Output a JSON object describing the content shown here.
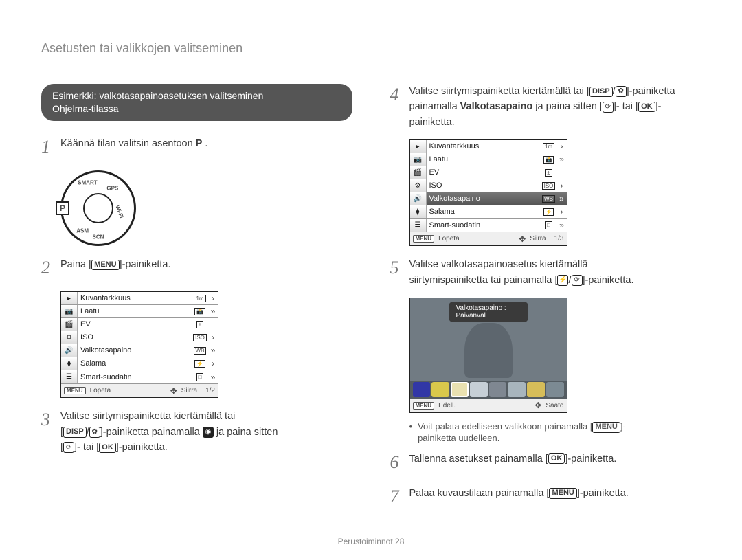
{
  "page_title": "Asetusten tai valikkojen valitseminen",
  "pill": {
    "line1": "Esimerkki: valkotasapainoasetuksen valitseminen",
    "line2": "Ohjelma-tilassa"
  },
  "dial": {
    "P": "P",
    "top": "SMART",
    "right_top": "GPS",
    "right_bottom": "Wi-Fi",
    "left_bottom": "ASM",
    "bottom": "SCN"
  },
  "buttons": {
    "menu": "MENU",
    "disp": "DISP",
    "ok": "OK"
  },
  "steps_left": {
    "1": {
      "num": "1",
      "pre": "Käännä tilan valitsin asentoon ",
      "mode": "P",
      "post": "."
    },
    "2": {
      "num": "2",
      "pre": "Paina [",
      "post": "]-painiketta."
    },
    "3": {
      "num": "3",
      "l1_pre": "Valitse siirtymispainiketta kiertämällä tai",
      "l2_pre": "[",
      "l2_mid": "]-painiketta painamalla ",
      "l2_post": " ja paina sitten",
      "l3_pre": "[",
      "l3_mid": "]- tai [",
      "l3_post": "]-painiketta."
    }
  },
  "steps_right": {
    "4": {
      "num": "4",
      "l1_pre": "Valitse siirtymispainiketta kiertämällä tai  [",
      "l1_post": "]-painiketta",
      "l2_pre": "painamalla ",
      "l2_strong": "Valkotasapaino",
      "l2_mid": " ja paina sitten [",
      "l2_mid2": "]- tai [",
      "l2_post": "]-painiketta."
    },
    "5": {
      "num": "5",
      "l1": "Valitse valkotasapainoasetus kiertämällä",
      "l2_pre": "siirtymispainiketta tai painamalla [",
      "l2_post": "]-painiketta."
    },
    "6": {
      "num": "6",
      "pre": "Tallenna asetukset painamalla [",
      "post": "]-painiketta."
    },
    "7": {
      "num": "7",
      "pre": "Palaa kuvaustilaan painamalla [",
      "post": "]-painiketta."
    }
  },
  "menu": {
    "items": [
      {
        "icon": "▸",
        "label": "Kuvantarkkuus",
        "val": "1m",
        "chev": "›"
      },
      {
        "icon": "📷",
        "label": "Laatu",
        "val": "📸",
        "chev": "»"
      },
      {
        "icon": "🎬",
        "label": "EV",
        "val": "±",
        "chev": ""
      },
      {
        "icon": "⚙",
        "label": "ISO",
        "val": "ISO",
        "chev": "›"
      },
      {
        "icon": "🔊",
        "label": "Valkotasapaino",
        "val": "WB",
        "chev": "»"
      },
      {
        "icon": "⧫",
        "label": "Salama",
        "val": "⚡",
        "chev": "›"
      },
      {
        "icon": "☰",
        "label": "Smart-suodatin",
        "val": "□",
        "chev": "»"
      }
    ],
    "footer_menu": "MENU",
    "footer_exit": "Lopeta",
    "footer_move": "Siirrä",
    "page_a": "1/2",
    "page_b": "1/3"
  },
  "wb": {
    "header": "Valkotasapaino : Päivänval",
    "opt_colors": [
      "#3137a6",
      "#d9c84b",
      "#e9e1b1",
      "#c6cfd6",
      "#7f8791",
      "#a8b5bd",
      "#d6bd59",
      "#7c8a93"
    ],
    "footer_menu": "MENU",
    "footer_back": "Edell.",
    "footer_adjust": "Säätö"
  },
  "note": {
    "bullet": "•",
    "pre": "Voit palata edelliseen valikkoon painamalla [",
    "post": "]-",
    "line2": "painiketta uudelleen."
  },
  "footer": {
    "label": "Perustoiminnot",
    "num": "28"
  }
}
